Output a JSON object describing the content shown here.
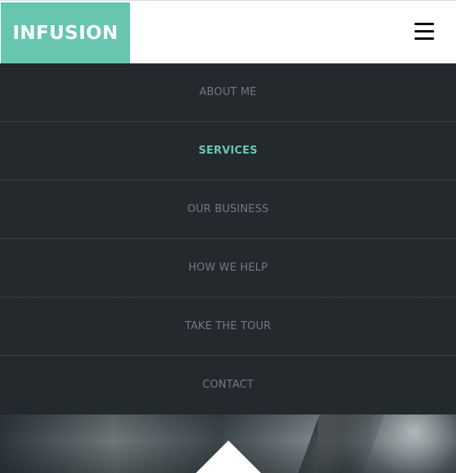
{
  "header": {
    "logo_text": "INFUSION",
    "menu_icon": "hamburger-menu-icon"
  },
  "nav": {
    "items": [
      {
        "label": "ABOUT ME",
        "active": false
      },
      {
        "label": "SERVICES",
        "active": true
      },
      {
        "label": "OUR BUSINESS",
        "active": false
      },
      {
        "label": "HOW WE HELP",
        "active": false
      },
      {
        "label": "TAKE THE TOUR",
        "active": false
      },
      {
        "label": "CONTACT",
        "active": false
      }
    ]
  },
  "colors": {
    "accent": "#68c6b0",
    "nav_background": "#23292d",
    "nav_text": "#727a7f"
  },
  "hero": {
    "scroll_icon": "up-triangle-icon"
  }
}
